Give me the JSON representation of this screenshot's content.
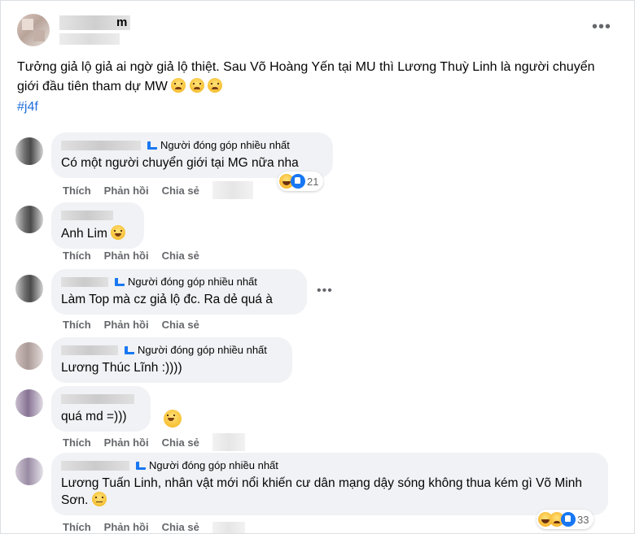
{
  "post": {
    "author_suffix": "m",
    "more_label": "•••",
    "text": "Tưởng giả lộ giả ai ngờ giả lộ thiệt. Sau Võ Hoàng Yến tại MU thì Lương Thuỳ Linh là người chuyển giới đầu tiên tham dự MW",
    "hashtag": "#j4f"
  },
  "actions": {
    "like": "Thích",
    "reply": "Phản hồi",
    "share": "Chia sẻ"
  },
  "badge": "Người đóng góp nhiều nhất",
  "comments": [
    {
      "text": "Có một người chuyển giới tại MG nữa nha",
      "reactions": "21"
    },
    {
      "text": "Anh Lim"
    },
    {
      "text": "Làm Top mà cz giả lộ đc. Ra dẻ quá à"
    },
    {
      "text": "Lương Thúc Lĩnh :))))"
    },
    {
      "text": "quá md =)))"
    },
    {
      "text": "Lương Tuấn Linh, nhân vật mới nổi khiến cư dân mạng dậy sóng không thua kém gì Võ Minh Sơn.",
      "reactions": "33"
    }
  ],
  "colors": {
    "hashtag": "#216fdb",
    "secondary_text": "#65676b",
    "bubble": "#f0f2f5",
    "like_blue": "#1877f2"
  },
  "icons": {
    "post_more": "more-horizontal-icon",
    "haha": "haha-reaction-icon",
    "sad": "sad-reaction-icon",
    "like": "like-reaction-icon",
    "badge": "top-fan-badge-icon"
  }
}
